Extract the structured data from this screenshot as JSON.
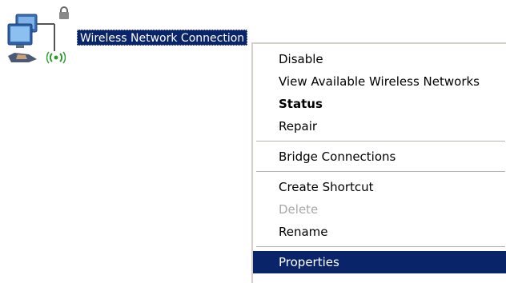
{
  "desktop_icon": {
    "label": "Wireless Network Connection",
    "icon": "network-computer-icon",
    "status_icon": "wireless-signal-icon",
    "lock_icon": "lock-icon"
  },
  "context_menu": {
    "items": [
      {
        "label": "Disable",
        "style": "normal"
      },
      {
        "label": "View Available Wireless Networks",
        "style": "normal"
      },
      {
        "label": "Status",
        "style": "bold"
      },
      {
        "label": "Repair",
        "style": "normal"
      },
      {
        "label": "Bridge Connections",
        "style": "normal"
      },
      {
        "label": "Create Shortcut",
        "style": "normal"
      },
      {
        "label": "Delete",
        "style": "disabled"
      },
      {
        "label": "Rename",
        "style": "normal"
      },
      {
        "label": "Properties",
        "style": "highlighted"
      }
    ]
  },
  "colors": {
    "selection": "#0a246a",
    "menu_background": "#ffffff",
    "disabled_text": "#a8a8a8",
    "wireless_green": "#2e9a2e"
  }
}
